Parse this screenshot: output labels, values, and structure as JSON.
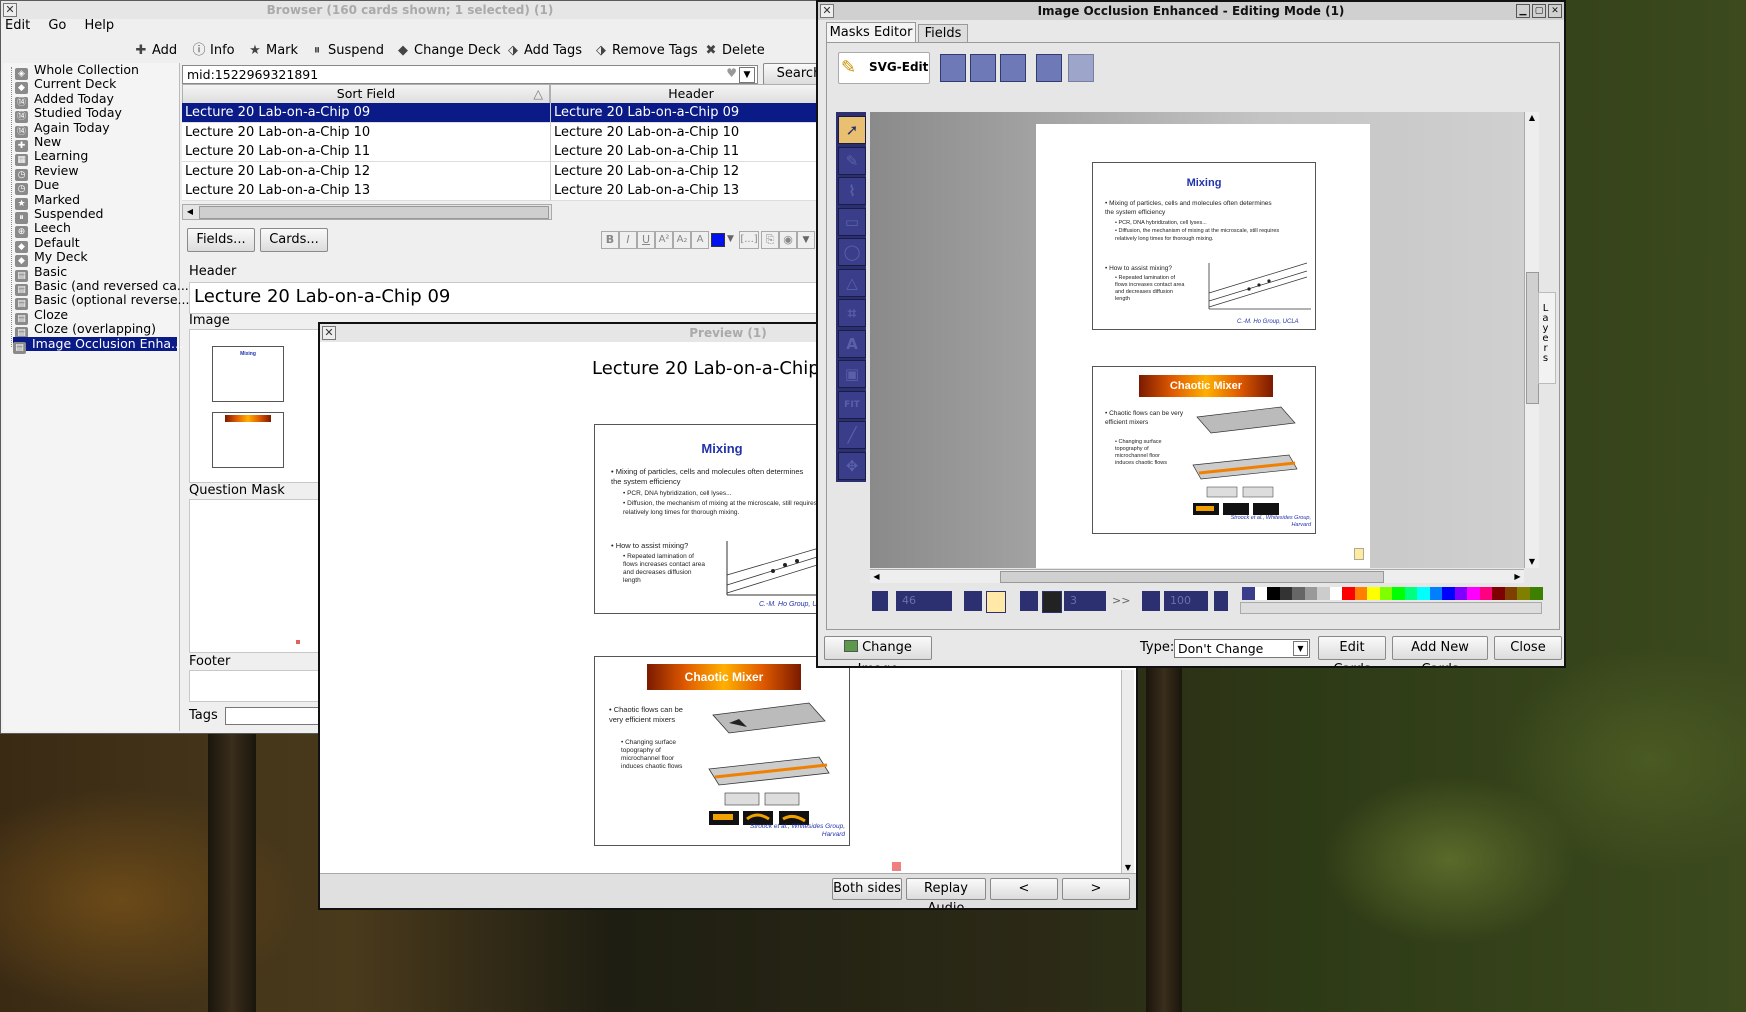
{
  "browser": {
    "title": "Browser (160 cards shown; 1 selected) (1)",
    "menu": [
      "Edit",
      "Go",
      "Help"
    ],
    "toolbar": {
      "add": "Add",
      "info": "Info",
      "mark": "Mark",
      "suspend": "Suspend",
      "change_deck": "Change Deck",
      "add_tags": "Add Tags",
      "remove_tags": "Remove Tags",
      "delete": "Delete"
    },
    "search_value": "mid:1522969321891",
    "search_button": "Search",
    "sidebar": [
      "Whole Collection",
      "Current Deck",
      "Added Today",
      "Studied Today",
      "Again Today",
      "New",
      "Learning",
      "Review",
      "Due",
      "Marked",
      "Suspended",
      "Leech",
      "Default",
      "My Deck",
      "Basic",
      "Basic (and reversed ca...",
      "Basic (optional reverse...",
      "Cloze",
      "Cloze (overlapping)",
      "Image Occlusion Enha..."
    ],
    "table": {
      "columns": [
        "Sort Field",
        "Header"
      ],
      "rows": [
        [
          "Lecture 20 Lab-on-a-Chip 09",
          "Lecture 20 Lab-on-a-Chip 09"
        ],
        [
          "Lecture 20 Lab-on-a-Chip 10",
          "Lecture 20 Lab-on-a-Chip 10"
        ],
        [
          "Lecture 20 Lab-on-a-Chip 11",
          "Lecture 20 Lab-on-a-Chip 11"
        ],
        [
          "Lecture 20 Lab-on-a-Chip 12",
          "Lecture 20 Lab-on-a-Chip 12"
        ],
        [
          "Lecture 20 Lab-on-a-Chip 13",
          "Lecture 20 Lab-on-a-Chip 13"
        ]
      ]
    },
    "fields_button": "Fields...",
    "cards_button": "Cards...",
    "editor": {
      "header_label": "Header",
      "header_value": "Lecture 20 Lab-on-a-Chip 09",
      "image_label": "Image",
      "question_mask_label": "Question Mask",
      "footer_label": "Footer",
      "tags_label": "Tags"
    }
  },
  "preview": {
    "title": "Preview (1)",
    "heading": "Lecture 20 Lab-on-a-Chip",
    "both_sides": "Both sides",
    "replay_audio": "Replay Audio",
    "prev": "<",
    "next": ">"
  },
  "slides": {
    "mixing_title": "Mixing",
    "mixing_b1": "Mixing of particles, cells and molecules often determines the system efficiency",
    "mixing_b1a": "PCR, DNA hybridization, cell lyses...",
    "mixing_b1b": "Diffusion, the mechanism of mixing at the microscale, still requires relatively long times for thorough mixing.",
    "mixing_b2": "How to assist mixing?",
    "mixing_b2a": "Repeated lamination of flows increases contact area and decreases diffusion length",
    "mixing_credit": "C.-M. Ho Group, UCLA",
    "chaotic_title": "Chaotic Mixer",
    "chaotic_b1": "Chaotic flows can be very efficient mixers",
    "chaotic_b1a": "Changing surface topography of microchannel floor induces chaotic flows",
    "chaotic_credit": "Stroock et al., Whitesides Group, Harvard"
  },
  "io_editor": {
    "title": "Image Occlusion Enhanced - Editing Mode (1)",
    "tabs": [
      "Masks Editor",
      "Fields"
    ],
    "svg_edit": "SVG-Edit",
    "zoom_value": "46",
    "stroke_value": "3",
    "opacity_value": "100",
    "layers_label": "Layers",
    "change_image": "Change Image",
    "type_label": "Type:",
    "type_value": "Don't Change",
    "edit_cards": "Edit Cards",
    "add_new_cards": "Add New Cards",
    "close": "Close",
    "palette": [
      "#3a3e8a",
      "#ffffff",
      "#000000",
      "#333333",
      "#666666",
      "#999999",
      "#cccccc",
      "#ffffff",
      "#ff0000",
      "#ff7f00",
      "#ffff00",
      "#7fff00",
      "#00ff00",
      "#00ff7f",
      "#00ffff",
      "#007fff",
      "#0000ff",
      "#7f00ff",
      "#ff00ff",
      "#ff007f",
      "#7f0000",
      "#7f3f00",
      "#7f7f00",
      "#3f7f00"
    ]
  }
}
